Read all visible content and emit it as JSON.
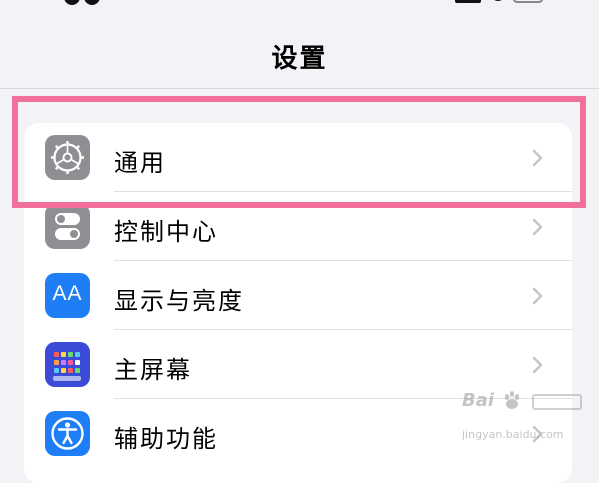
{
  "nav": {
    "title": "设置"
  },
  "rows": [
    {
      "label": "通用",
      "icon": "gear-icon",
      "color": "#8e8e93"
    },
    {
      "label": "控制中心",
      "icon": "toggle-icon",
      "color": "#8e8e93"
    },
    {
      "label": "显示与亮度",
      "icon": "text-size-icon",
      "icon_text": "AA",
      "color": "#1e7ef5"
    },
    {
      "label": "主屏幕",
      "icon": "home-grid-icon",
      "color": "#3b4bd8"
    },
    {
      "label": "辅助功能",
      "icon": "accessibility-icon",
      "color": "#1e7ef5"
    }
  ],
  "highlight_color": "#f0709a",
  "watermark": {
    "brand": "Bai",
    "url": "jingyan.baidu.com"
  }
}
